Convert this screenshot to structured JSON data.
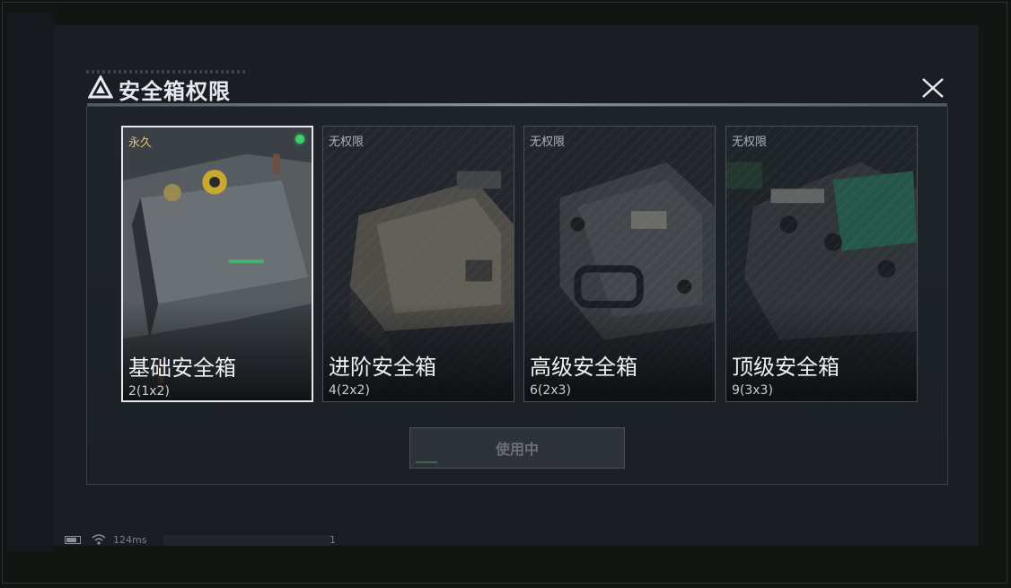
{
  "dialog": {
    "title": "安全箱权限",
    "close_icon": "close-icon",
    "use_button_label": "使用中"
  },
  "cards": [
    {
      "tag": "永久",
      "name": "基础安全箱",
      "size": "2(1x2)",
      "selected": true,
      "active": true
    },
    {
      "tag": "无权限",
      "name": "进阶安全箱",
      "size": "4(2x2)",
      "selected": false,
      "active": false
    },
    {
      "tag": "无权限",
      "name": "高级安全箱",
      "size": "6(2x3)",
      "selected": false,
      "active": false
    },
    {
      "tag": "无权限",
      "name": "顶级安全箱",
      "size": "9(3x3)",
      "selected": false,
      "active": false
    }
  ],
  "status_bar": {
    "ping": "124ms",
    "info_number": "1",
    "battery_icon": "battery-icon",
    "wifi_icon": "wifi-icon"
  },
  "colors": {
    "active_dot": "#3ccf6a",
    "permanent_tag": "#e0c27a",
    "selected_border": "#e8e8e8"
  }
}
